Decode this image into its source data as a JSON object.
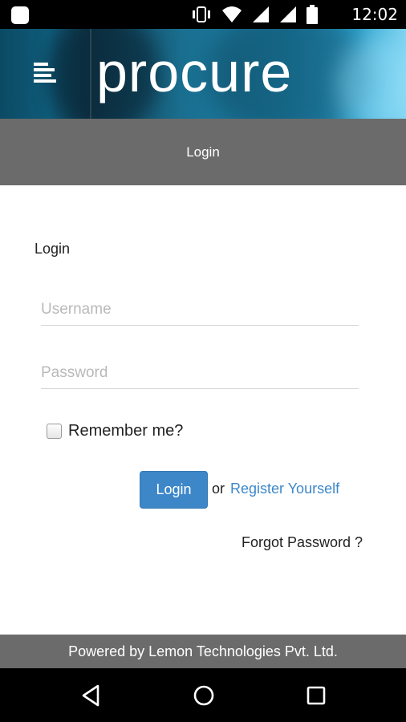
{
  "status_bar": {
    "time": "12:02",
    "icons": [
      "notification-icon",
      "vibrate-icon",
      "wifi-icon",
      "signal-icon",
      "battery-icon"
    ]
  },
  "banner": {
    "logo_text": "procure",
    "menu_icon": "menu-icon"
  },
  "title_bar": {
    "title": "Login"
  },
  "form": {
    "heading": "Login",
    "username": {
      "value": "",
      "placeholder": "Username"
    },
    "password": {
      "value": "",
      "placeholder": "Password"
    },
    "remember_label": "Remember me?",
    "remember_checked": false,
    "login_button": "Login",
    "or_text": "or",
    "register_link": "Register Yourself",
    "forgot_link": "Forgot Password ?"
  },
  "footer": {
    "text": "Powered by Lemon Technologies Pvt. Ltd."
  },
  "nav_bar": {
    "buttons": [
      "back-icon",
      "home-icon",
      "recent-apps-icon"
    ]
  },
  "colors": {
    "accent": "#3d87c9",
    "bar_gray": "#6b6b6b",
    "system_bar": "#000000"
  }
}
